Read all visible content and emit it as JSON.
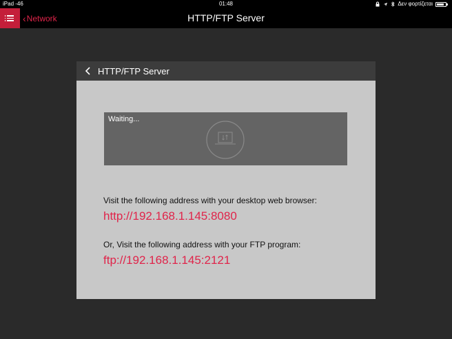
{
  "statusbar": {
    "carrier": "iPad",
    "signal": "-46",
    "time": "01:48",
    "charging_text": "Δεν φορτίζεται",
    "battery_level": 0.85
  },
  "navbar": {
    "back_label": "Network",
    "title": "HTTP/FTP Server"
  },
  "panel": {
    "title": "HTTP/FTP Server",
    "status_text": "Waiting...",
    "http_instruction": "Visit the following address with your desktop web browser:",
    "http_url": "http://192.168.1.145:8080",
    "ftp_instruction": "Or, Visit the following address with your FTP program:",
    "ftp_url": "ftp://192.168.1.145:2121"
  },
  "colors": {
    "accent": "#e0244a",
    "menu_button": "#c41e3a",
    "panel_bg": "#c8c8c8",
    "page_bg": "#2a2a2a"
  }
}
